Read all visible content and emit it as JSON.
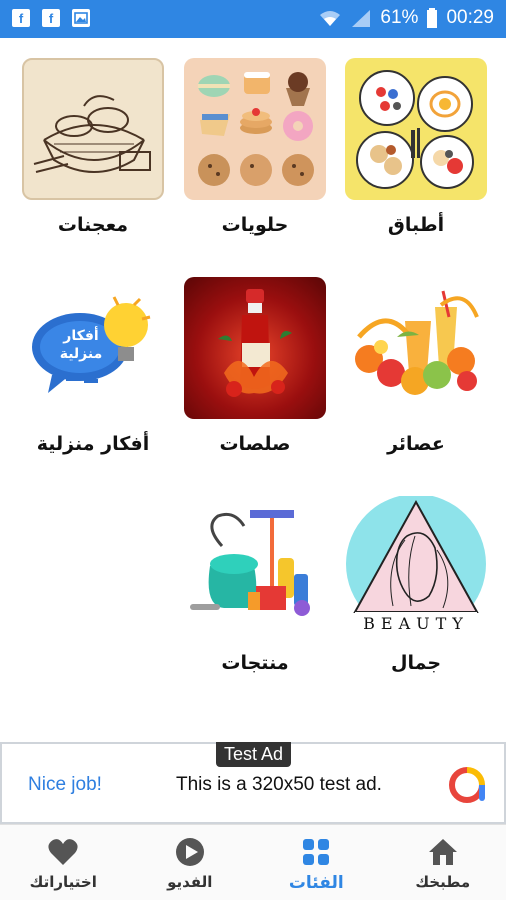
{
  "status_bar": {
    "battery": "61%",
    "time": "00:29"
  },
  "categories": [
    {
      "label": "أطباق"
    },
    {
      "label": "حلويات"
    },
    {
      "label": "معجنات"
    },
    {
      "label": "عصائر"
    },
    {
      "label": "صلصات"
    },
    {
      "label": "أفكار منزلية",
      "image_text": "أفكار منزلية"
    },
    {
      "label": "جمال",
      "image_text": "BEAUTY"
    },
    {
      "label": "منتجات"
    }
  ],
  "ad": {
    "badge": "Test Ad",
    "cta": "Nice job!",
    "text": "This is a 320x50 test ad."
  },
  "bottom_nav": [
    {
      "label": "مطبخك",
      "icon": "home-icon"
    },
    {
      "label": "الفئات",
      "icon": "grid-icon",
      "active": true
    },
    {
      "label": "الفديو",
      "icon": "play-icon"
    },
    {
      "label": "اختياراتك",
      "icon": "heart-icon"
    }
  ],
  "colors": {
    "status_bar": "#2f86e3",
    "active_nav": "#2f86e3",
    "ad_cta": "#2f7fe0"
  }
}
